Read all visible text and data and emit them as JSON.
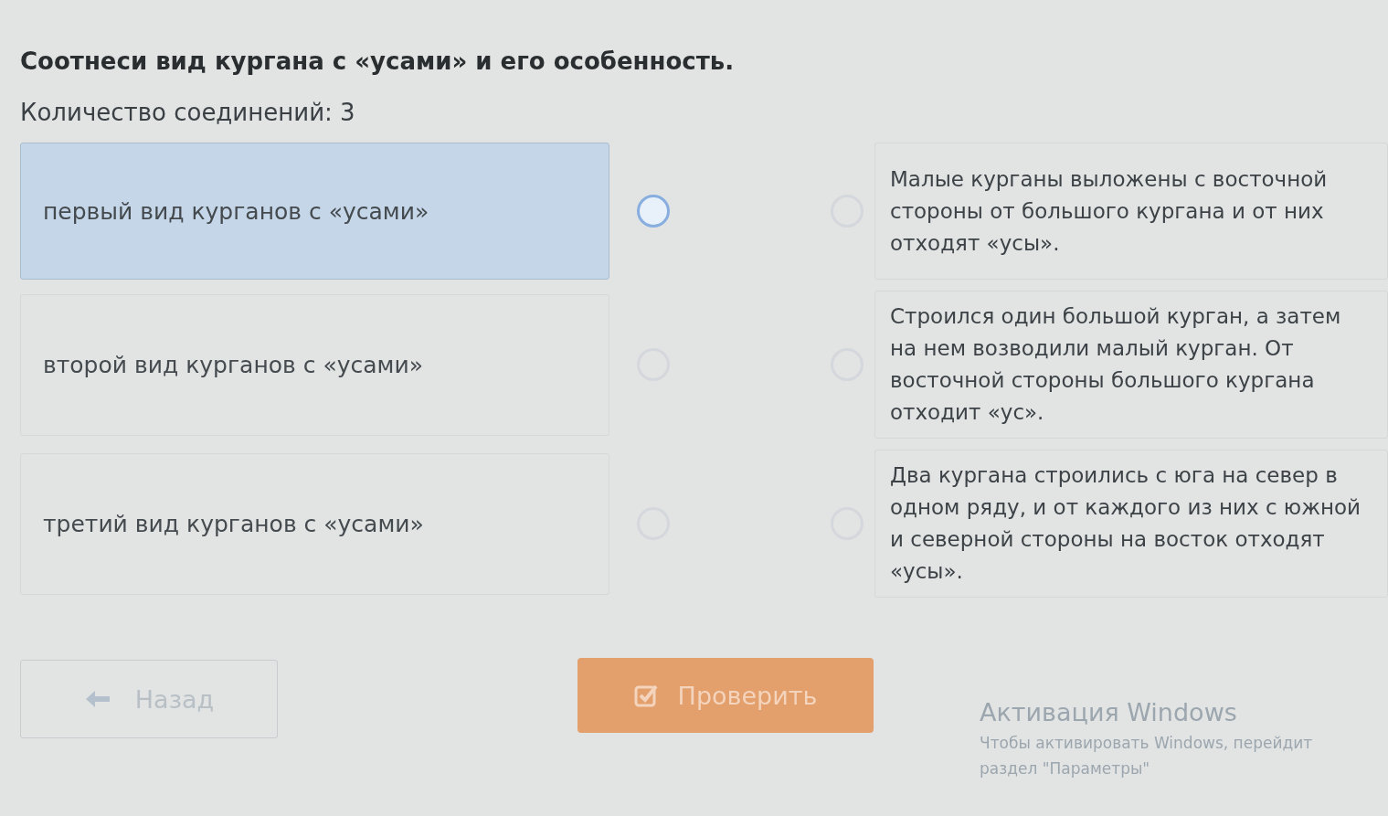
{
  "question": {
    "title": "Соотнеси вид кургана с «усами» и его особенность.",
    "connections": "Количество соединений: 3"
  },
  "left_items": [
    {
      "label": "первый вид курганов с «усами»",
      "selected": true
    },
    {
      "label": "второй вид курганов с «усами»",
      "selected": false
    },
    {
      "label": "третий вид курганов с «усами»",
      "selected": false
    }
  ],
  "right_items": [
    {
      "label": "Малые курганы выложены с восточной стороны от большого кургана и от них отходят «усы»."
    },
    {
      "label": "Строился один большой курган, а затем на нем возводили малый курган. От восточной стороны большого кургана отходит «ус»."
    },
    {
      "label": "Два кургана строились с юга на север в одном ряду, и от каждого из них с южной и северной стороны на восток отходят «усы»."
    }
  ],
  "buttons": {
    "back": "Назад",
    "check": "Проверить"
  },
  "activation": {
    "title": "Активация Windows",
    "line_1": "Чтобы активировать Windows, перейдит",
    "line_2": "раздел \"Параметры\""
  }
}
